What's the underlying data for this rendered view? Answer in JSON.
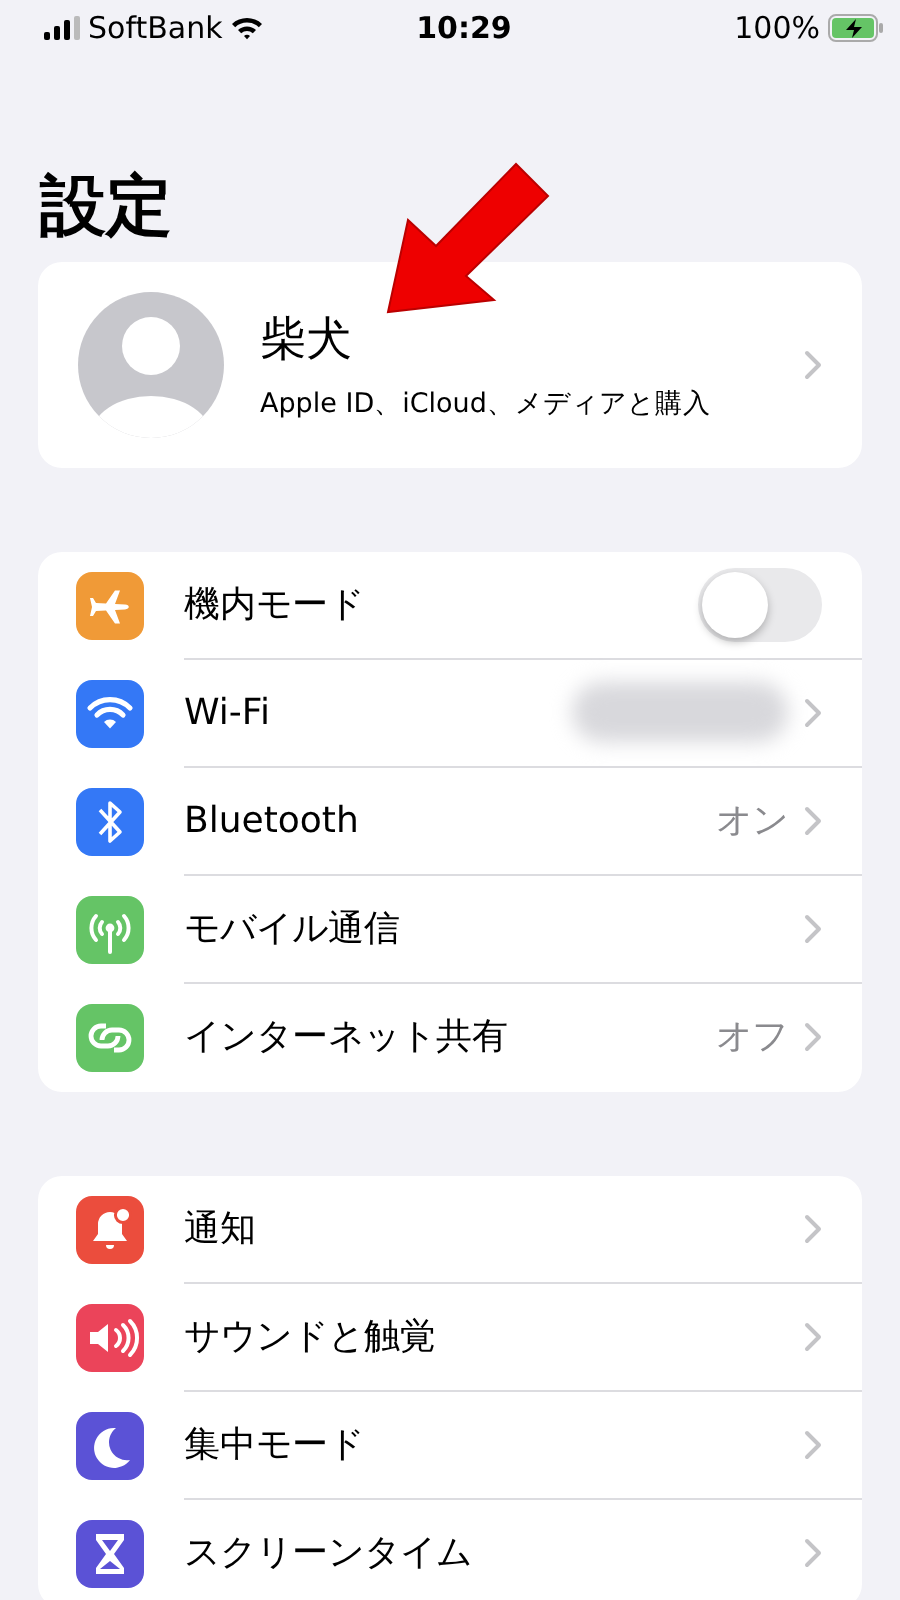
{
  "status_bar": {
    "carrier": "SoftBank",
    "time": "10:29",
    "battery": "100%",
    "charging": true
  },
  "title": "設定",
  "profile": {
    "name": "柴犬",
    "subtitle": "Apple ID、iCloud、メディアと購入"
  },
  "groups": [
    {
      "items": [
        {
          "kind": "toggle",
          "label": "機内モード",
          "color": "#f09a37",
          "on": false
        },
        {
          "kind": "link",
          "label": "Wi-Fi",
          "color": "#3478f6",
          "value_blurred": true
        },
        {
          "kind": "link",
          "label": "Bluetooth",
          "color": "#3478f6",
          "value": "オン"
        },
        {
          "kind": "link",
          "label": "モバイル通信",
          "color": "#65c466"
        },
        {
          "kind": "link",
          "label": "インターネット共有",
          "color": "#65c466",
          "value": "オフ"
        }
      ]
    },
    {
      "items": [
        {
          "kind": "link",
          "label": "通知",
          "color": "#eb4d3d"
        },
        {
          "kind": "link",
          "label": "サウンドと触覚",
          "color": "#eb445a"
        },
        {
          "kind": "link",
          "label": "集中モード",
          "color": "#5b52d6"
        },
        {
          "kind": "link",
          "label": "スクリーンタイム",
          "color": "#5b52d6"
        }
      ]
    }
  ]
}
